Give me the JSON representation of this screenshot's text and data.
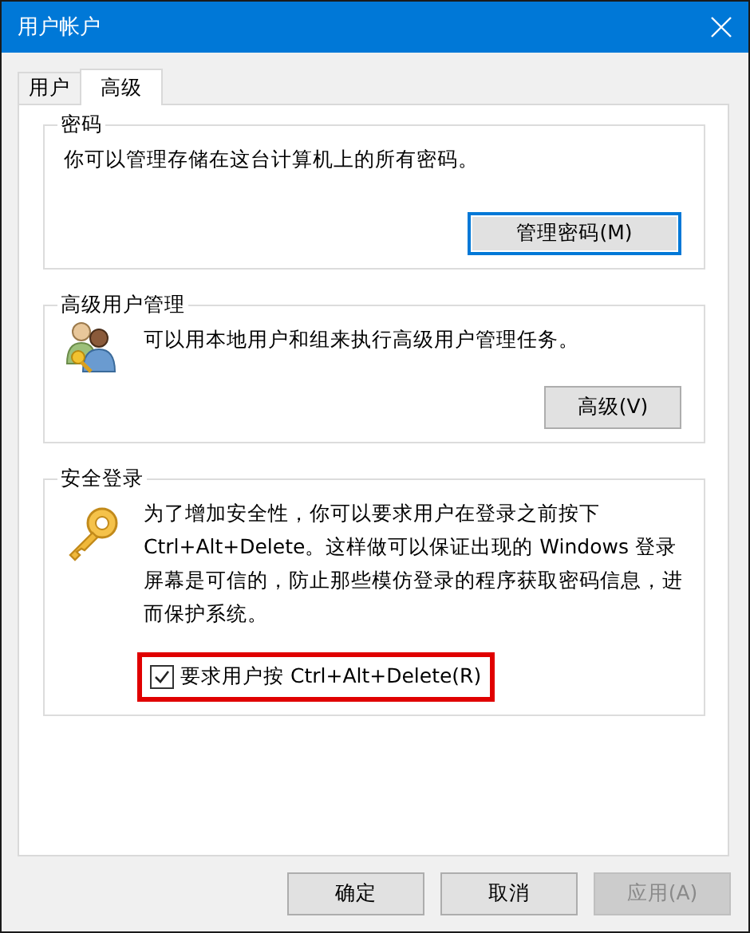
{
  "window": {
    "title": "用户帐户"
  },
  "tabs": [
    {
      "label": "用户",
      "selected": false
    },
    {
      "label": "高级",
      "selected": true
    }
  ],
  "groups": [
    {
      "title": "密码",
      "kind": "plain",
      "text": "你可以管理存储在这台计算机上的所有密码。",
      "button": {
        "label": "管理密码(M)",
        "focused": true
      }
    },
    {
      "title": "高级用户管理",
      "kind": "users",
      "text": "可以用本地用户和组来执行高级用户管理任务。",
      "button": {
        "label": "高级(V)",
        "focused": false
      }
    },
    {
      "title": "安全登录",
      "kind": "key",
      "text": "为了增加安全性，你可以要求用户在登录之前按下 Ctrl+Alt+Delete。这样做可以保证出现的 Windows 登录屏幕是可信的，防止那些模仿登录的程序获取密码信息，进而保护系统。",
      "checkbox": {
        "label": "要求用户按 Ctrl+Alt+Delete(R)",
        "checked": true,
        "highlighted": true
      }
    }
  ],
  "buttons": [
    {
      "label": "确定",
      "disabled": false
    },
    {
      "label": "取消",
      "disabled": false
    },
    {
      "label": "应用(A)",
      "disabled": true
    }
  ]
}
